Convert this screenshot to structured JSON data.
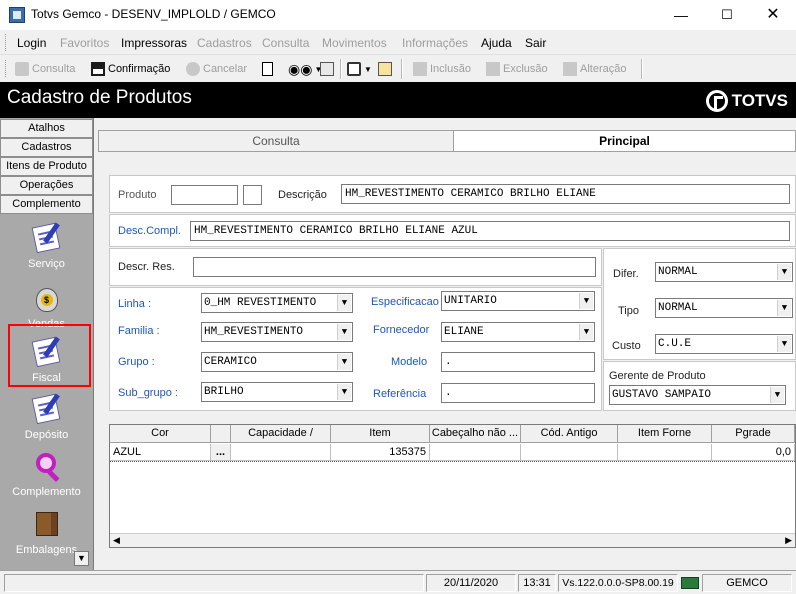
{
  "window": {
    "title": "Totvs Gemco - DESENV_IMPLOLD / GEMCO"
  },
  "menu": [
    "Login",
    "Favoritos",
    "Impressoras",
    "Cadastros",
    "Consulta",
    "Movimentos",
    "Informações",
    "Ajuda",
    "Sair"
  ],
  "toolbar": {
    "consulta": "Consulta",
    "confirmacao": "Confirmação",
    "cancelar": "Cancelar",
    "inclusao": "Inclusão",
    "exclusao": "Exclusão",
    "alteracao": "Alteração"
  },
  "header": {
    "title": "Cadastro de Produtos",
    "logo": "TOTVS"
  },
  "nav": {
    "buttons": [
      "Atalhos",
      "Cadastros",
      "Itens de Produto",
      "Operações",
      "Complemento"
    ],
    "icons": [
      "Serviço",
      "Vendas",
      "Fiscal",
      "Depósito",
      "Complemento",
      "Embalagens"
    ]
  },
  "tabs": {
    "consulta": "Consulta",
    "principal": "Principal"
  },
  "form": {
    "produto_label": "Produto",
    "produto_value": "",
    "produto_digit": "",
    "descricao_label": "Descrição",
    "descricao_value": "HM_REVESTIMENTO CERAMICO BRILHO ELIANE",
    "desc_compl_label": "Desc.Compl.",
    "desc_compl_value": "HM_REVESTIMENTO CERAMICO BRILHO ELIANE AZUL",
    "descr_res_label": "Descr. Res.",
    "descr_res_value": "",
    "linha_label": "Linha :",
    "linha_value": "0_HM REVESTIMENTO",
    "familia_label": "Familia :",
    "familia_value": "HM_REVESTIMENTO",
    "grupo_label": "Grupo :",
    "grupo_value": "CERAMICO",
    "subgrupo_label": "Sub_grupo :",
    "subgrupo_value": "BRILHO",
    "especificacao_label": "Especificacao",
    "especificacao_value": "UNITARIO",
    "fornecedor_label": "Fornecedor",
    "fornecedor_value": "ELIANE",
    "modelo_label": "Modelo",
    "modelo_value": ".",
    "referencia_label": "Referência",
    "referencia_value": ".",
    "difer_label": "Difer.",
    "difer_value": "NORMAL",
    "tipo_label": "Tipo",
    "tipo_value": "NORMAL",
    "custo_label": "Custo",
    "custo_value": "C.U.E",
    "gerente_label": "Gerente de Produto",
    "gerente_value": "GUSTAVO SAMPAIO"
  },
  "grid": {
    "headers": [
      "Cor",
      "",
      "Capacidade /",
      "Item",
      "Cabeçalho não ...",
      "Cód. Antigo",
      "Item Forne",
      "Pgrade"
    ],
    "row": [
      "AZUL",
      "...",
      "",
      "135375",
      "",
      "",
      "",
      "0,0"
    ]
  },
  "status": {
    "date": "20/11/2020",
    "time": "13:31",
    "version": "Vs.122.0.0.0-SP8.00.19",
    "company": "GEMCO"
  }
}
